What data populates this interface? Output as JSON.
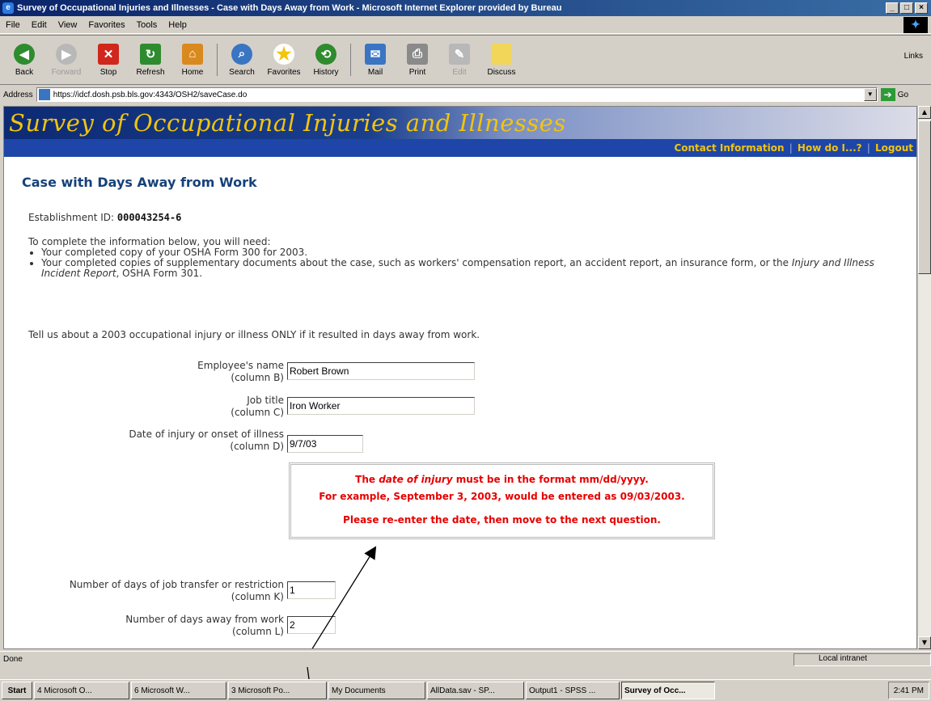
{
  "window": {
    "title": "Survey of Occupational Injuries and Illnesses - Case with Days Away from Work - Microsoft Internet Explorer provided by Bureau",
    "buttons": [
      "_",
      "□",
      "×"
    ]
  },
  "menu": [
    "File",
    "Edit",
    "View",
    "Favorites",
    "Tools",
    "Help"
  ],
  "toolbar": {
    "items": [
      {
        "label": "Back",
        "icon": "back-arrow-icon",
        "color": "#2e8b2e"
      },
      {
        "label": "Forward",
        "icon": "forward-arrow-icon",
        "color": "#a0a0a0"
      },
      {
        "label": "Stop",
        "icon": "stop-icon",
        "color": "#d0261c"
      },
      {
        "label": "Refresh",
        "icon": "refresh-icon",
        "color": "#2e8b2e"
      },
      {
        "label": "Home",
        "icon": "home-icon",
        "color": "#d98a1e"
      },
      {
        "label": "Search",
        "icon": "search-icon",
        "color": "#3a75c4"
      },
      {
        "label": "Favorites",
        "icon": "star-icon",
        "color": "#f2c40d"
      },
      {
        "label": "History",
        "icon": "history-icon",
        "color": "#2e8b2e"
      },
      {
        "label": "Mail",
        "icon": "mail-icon",
        "color": "#3a75c4"
      },
      {
        "label": "Print",
        "icon": "printer-icon",
        "color": "#8a8a8a"
      },
      {
        "label": "Edit",
        "icon": "edit-icon",
        "color": "#a0a0a0"
      },
      {
        "label": "Discuss",
        "icon": "discuss-icon",
        "color": "#f2d65a"
      }
    ],
    "links": "Links"
  },
  "address": {
    "label": "Address",
    "url": "https://idcf.dosh.psb.bls.gov:4343/OSH2/saveCase.do",
    "go": "Go"
  },
  "page": {
    "banner": "Survey of Occupational Injuries and Illnesses",
    "nav": [
      "Contact Information",
      "How do I...?",
      "Logout"
    ],
    "heading": "Case with Days Away from Work",
    "est_label": "Establishment ID: ",
    "est_id": "000043254-6",
    "intro": "To complete the information below, you will need:",
    "bullet1": "Your completed copy of your OSHA Form 300 for 2003.",
    "bullet2a": "Your completed copies of supplementary documents about the case, such as workers' compensation report, an accident report, an insurance form, or the ",
    "bullet2b": "Injury and Illness Incident Report",
    "bullet2c": ", OSHA Form 301.",
    "instruction": "Tell us about a 2003 occupational injury or illness ONLY if it resulted in days away from work.",
    "fields": {
      "name": {
        "label": "Employee's name",
        "col": "(column B)",
        "value": "Robert Brown"
      },
      "title": {
        "label": "Job title",
        "col": "(column C)",
        "value": "Iron Worker"
      },
      "date": {
        "label": "Date of injury or onset of illness",
        "col": "(column D)",
        "value": "9/7/03"
      },
      "transfer": {
        "label": "Number of days of job transfer or restriction",
        "col": "(column K)",
        "value": "1"
      },
      "away": {
        "label": "Number of days away from work",
        "col": "(column L)",
        "value": "2"
      }
    },
    "error": {
      "l1a": "The ",
      "l1b": "date of injury",
      "l1c": " must be in the format mm/dd/yyyy.",
      "l2": "For example, September 3, 2003, would be entered as 09/03/2003.",
      "l3": "Please re-enter the date, then move to the next question."
    }
  },
  "status": {
    "text": "Done",
    "zone": "Local intranet"
  },
  "taskbar": {
    "start": "Start",
    "tasks": [
      "4 Microsoft O...",
      "6 Microsoft W...",
      "3 Microsoft Po...",
      "My Documents",
      "AllData.sav - SP...",
      "Output1 - SPSS ...",
      "Survey of Occ..."
    ],
    "clock": "2:41 PM"
  }
}
